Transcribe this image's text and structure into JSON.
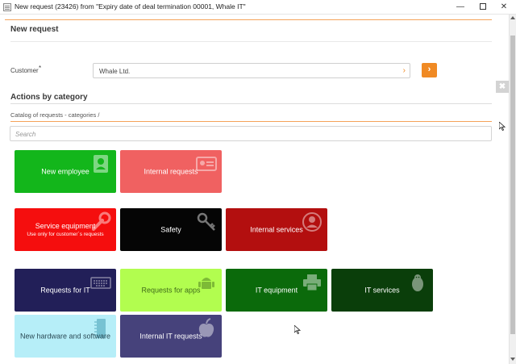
{
  "window": {
    "title": "New request (23426) from \"Expiry date of deal termination 00001, Whale IT\"",
    "min_glyph": "—",
    "close_glyph": "✕"
  },
  "header": {
    "title": "New request"
  },
  "customer": {
    "label": "Customer",
    "required_mark": "*",
    "value": "Whale Ltd.",
    "chevron": "›",
    "go_glyph": "›"
  },
  "side_close_glyph": "✖",
  "actions": {
    "title": "Actions by category",
    "breadcrumb": "Catalog of requests - categories  /",
    "search_placeholder": "Search"
  },
  "tiles": [
    {
      "label": "New employee",
      "color": "#13b61b",
      "icon": "user-card-icon"
    },
    {
      "label": "Internal requests",
      "color": "#f06161",
      "icon": "id-card-icon"
    },
    {
      "label": "Service equipment",
      "sub": "Use only for customer´s requests",
      "color": "#f50e0e",
      "icon": "wrench-icon"
    },
    {
      "label": "Safety",
      "color": "#050505",
      "icon": "key-icon"
    },
    {
      "label": "Internal services",
      "color": "#b30f0f",
      "icon": "user-circle-icon"
    },
    {
      "label": "Requests for IT",
      "color": "#221f58",
      "icon": "keyboard-icon"
    },
    {
      "label": "Requests for apps",
      "color": "#b2fd4f",
      "text_color": "#3f6b1a",
      "icon": "android-icon"
    },
    {
      "label": "IT equipment",
      "color": "#0b6a0b",
      "icon": "printer-icon"
    },
    {
      "label": "IT services",
      "color": "#0a3e0a",
      "icon": "linux-icon"
    },
    {
      "label": "New hardware and software",
      "color": "#b6eef8",
      "text_color": "#2b4a55",
      "icon": "chip-icon"
    },
    {
      "label": "Internal IT requests",
      "color": "#46427b",
      "icon": "apple-icon"
    }
  ]
}
